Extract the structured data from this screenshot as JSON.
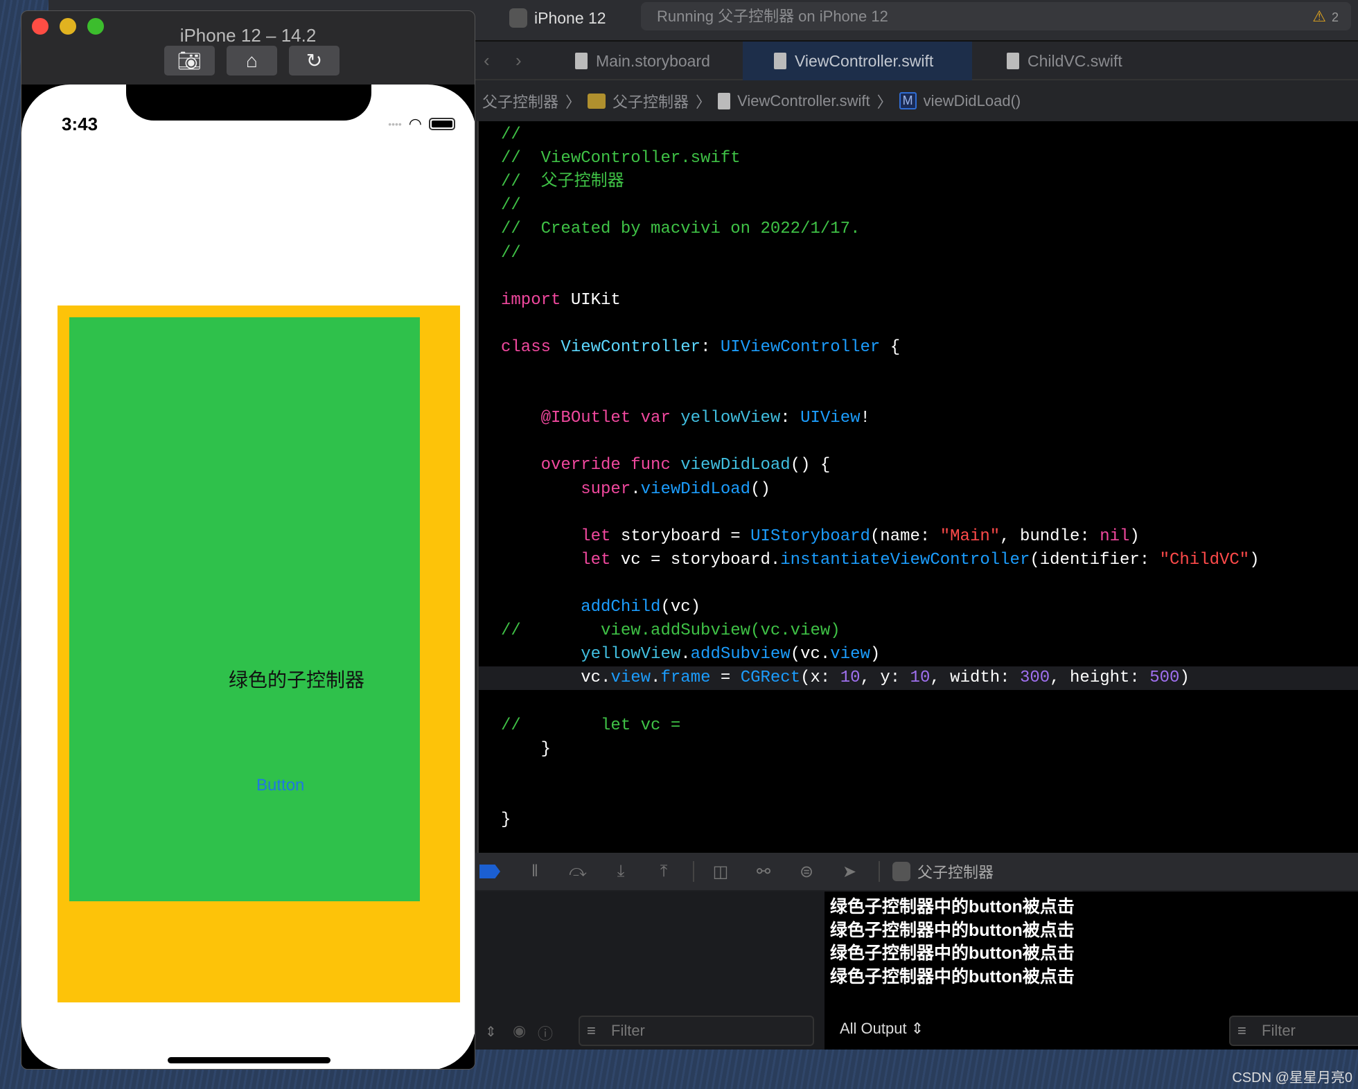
{
  "simulator": {
    "title": "iPhone 12 – 14.2",
    "buttons": [
      "screenshot",
      "home",
      "rotate"
    ],
    "time": "3:43",
    "child_label": "绿色的子控制器",
    "button_label": "Button",
    "colors": {
      "yellow": "#fdc309",
      "green": "#2fc14b"
    }
  },
  "toolbar": {
    "scheme_device": "iPhone 12",
    "status": "Running 父子控制器 on iPhone 12",
    "warning_count": "2"
  },
  "tabs": [
    {
      "label": "Main.storyboard"
    },
    {
      "label": "ViewController.swift",
      "active": true
    },
    {
      "label": "ChildVC.swift"
    }
  ],
  "jumpbar": [
    "父子控制器",
    "父子控制器",
    "ViewController.swift",
    "viewDidLoad()"
  ],
  "jumpbar_method_badge": "M",
  "code": {
    "highlighted_line": 24,
    "lines": [
      [
        [
          "//",
          "c"
        ]
      ],
      [
        [
          "//  ViewController.swift",
          "c"
        ]
      ],
      [
        [
          "//  父子控制器",
          "c"
        ]
      ],
      [
        [
          "//",
          "c"
        ]
      ],
      [
        [
          "//  Created by macvivi on 2022/1/17.",
          "c"
        ]
      ],
      [
        [
          "//",
          "c"
        ]
      ],
      [],
      [
        [
          "import",
          "k"
        ],
        [
          " UIKit",
          "p"
        ]
      ],
      [],
      [
        [
          "class",
          "k"
        ],
        [
          " ",
          "p"
        ],
        [
          "ViewController",
          "d"
        ],
        [
          ": ",
          "p"
        ],
        [
          "UIViewController",
          "t"
        ],
        [
          " {",
          "p"
        ]
      ],
      [],
      [],
      [
        [
          "    @IBOutlet",
          "k"
        ],
        [
          " var",
          "k"
        ],
        [
          " ",
          "p"
        ],
        [
          "yellowView",
          "v"
        ],
        [
          ": ",
          "p"
        ],
        [
          "UIView",
          "t"
        ],
        [
          "!",
          "p"
        ]
      ],
      [],
      [
        [
          "    override",
          "k"
        ],
        [
          " func",
          "k"
        ],
        [
          " ",
          "p"
        ],
        [
          "viewDidLoad",
          "v"
        ],
        [
          "() {",
          "p"
        ]
      ],
      [
        [
          "        super",
          "k"
        ],
        [
          ".",
          "p"
        ],
        [
          "viewDidLoad",
          "f"
        ],
        [
          "()",
          "p"
        ]
      ],
      [],
      [
        [
          "        let",
          "k"
        ],
        [
          " storyboard = ",
          "p"
        ],
        [
          "UIStoryboard",
          "t"
        ],
        [
          "(name: ",
          "p"
        ],
        [
          "\"Main\"",
          "s"
        ],
        [
          ", bundle: ",
          "p"
        ],
        [
          "nil",
          "k"
        ],
        [
          ")",
          "p"
        ]
      ],
      [
        [
          "        let",
          "k"
        ],
        [
          " vc = storyboard.",
          "p"
        ],
        [
          "instantiateViewController",
          "f"
        ],
        [
          "(identifier: ",
          "p"
        ],
        [
          "\"ChildVC\"",
          "s"
        ],
        [
          ")",
          "p"
        ]
      ],
      [],
      [
        [
          "        addChild",
          "f"
        ],
        [
          "(vc)",
          "p"
        ]
      ],
      [
        [
          "//        view.addSubview(vc.view)",
          "c"
        ]
      ],
      [
        [
          "        yellowView",
          "v"
        ],
        [
          ".",
          "p"
        ],
        [
          "addSubview",
          "f"
        ],
        [
          "(vc.",
          "p"
        ],
        [
          "view",
          "f"
        ],
        [
          ")",
          "p"
        ]
      ],
      [
        [
          "        vc.",
          "p"
        ],
        [
          "view",
          "f"
        ],
        [
          ".",
          "p"
        ],
        [
          "frame",
          "f"
        ],
        [
          " = ",
          "p"
        ],
        [
          "CGRect",
          "t"
        ],
        [
          "(x: ",
          "p"
        ],
        [
          "10",
          "n"
        ],
        [
          ", y: ",
          "p"
        ],
        [
          "10",
          "n"
        ],
        [
          ", width: ",
          "p"
        ],
        [
          "300",
          "n"
        ],
        [
          ", height: ",
          "p"
        ],
        [
          "500",
          "n"
        ],
        [
          ")",
          "p"
        ]
      ],
      [],
      [
        [
          "//        let vc =",
          "c"
        ]
      ],
      [
        [
          "    }",
          "p"
        ]
      ],
      [],
      [],
      [
        [
          "}",
          "p"
        ]
      ]
    ]
  },
  "debug_bar": {
    "target": "父子控制器"
  },
  "console": {
    "output": [
      "绿色子控制器中的button被点击",
      "绿色子控制器中的button被点击",
      "绿色子控制器中的button被点击",
      "绿色子控制器中的button被点击"
    ],
    "filter_placeholder": "Filter",
    "output_selector": "All Output",
    "filter_placeholder_right": "Filter"
  },
  "watermark": "CSDN @星星月亮0"
}
